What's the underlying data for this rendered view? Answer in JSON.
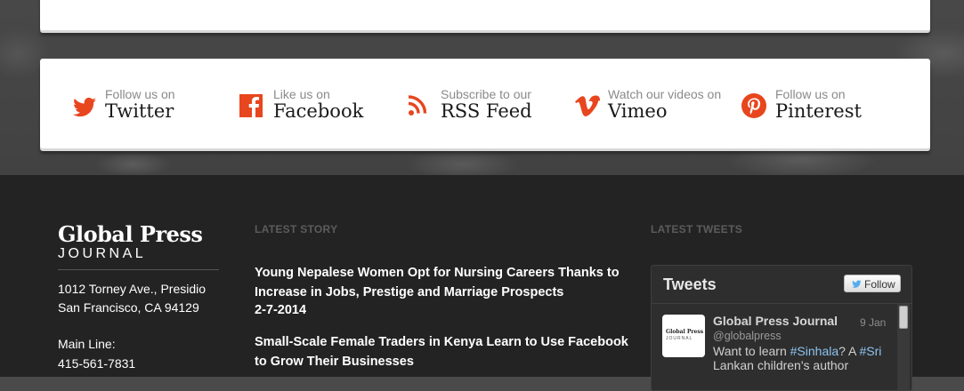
{
  "social": [
    {
      "small": "Follow us on",
      "big": "Twitter",
      "icon": "twitter-icon"
    },
    {
      "small": "Like us on",
      "big": "Facebook",
      "icon": "facebook-icon"
    },
    {
      "small": "Subscribe to our",
      "big": "RSS Feed",
      "icon": "rss-icon"
    },
    {
      "small": "Watch our videos on",
      "big": "Vimeo",
      "icon": "vimeo-icon"
    },
    {
      "small": "Follow us on",
      "big": "Pinterest",
      "icon": "pinterest-icon"
    }
  ],
  "accent_color": "#e8461e",
  "footer": {
    "logo_title": "Global Press",
    "logo_sub": "JOURNAL",
    "address": [
      "1012 Torney Ave., Presidio",
      "San Francisco, CA 94129"
    ],
    "main_line_label": "Main Line:",
    "main_line_number": "415-561-7831",
    "latest_story_label": "LATEST STORY",
    "stories": [
      {
        "title": "Young Nepalese Women Opt for Nursing Careers Thanks to Increase in Jobs, Prestige and Marriage Prospects",
        "date": "2-7-2014"
      },
      {
        "title": "Small-Scale Female Traders in Kenya Learn to Use Facebook to Grow Their Businesses",
        "date": ""
      }
    ],
    "latest_tweets_label": "LATEST TWEETS"
  },
  "tweets": {
    "title": "Tweets",
    "follow_label": "Follow",
    "tweet": {
      "name": "Global Press Journal",
      "handle": "@globalpress",
      "date": "9 Jan",
      "text_1": "Want to learn ",
      "tag_1": "#Sinhala",
      "text_2": "? A ",
      "tag_2": "#Sri",
      "text_3": " Lankan children's author",
      "avatar_line1": "Global Press",
      "avatar_line2": "JOURNAL"
    }
  }
}
